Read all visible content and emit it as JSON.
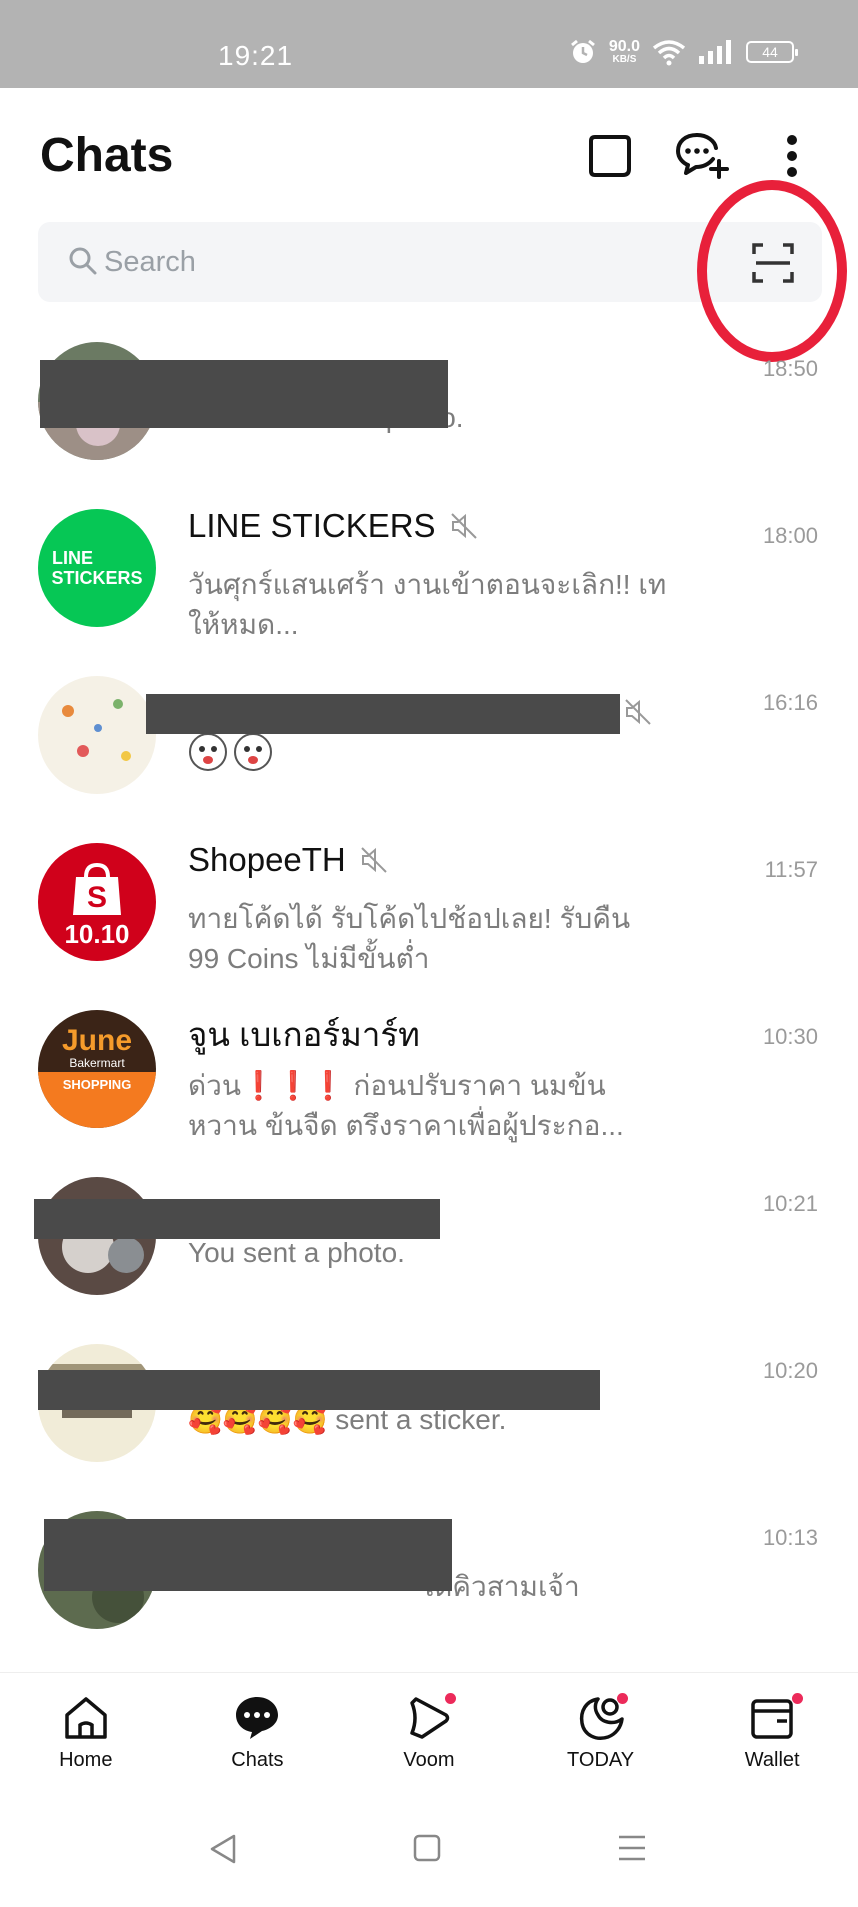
{
  "status_bar": {
    "time": "19:21",
    "net_speed_value": "90.0",
    "net_speed_unit": "KB/S",
    "battery": "44"
  },
  "header": {
    "title": "Chats"
  },
  "search": {
    "placeholder": "Search"
  },
  "chats": [
    {
      "name": "",
      "preview": "BaiBoon sent a photo.",
      "time": "18:50",
      "muted": false,
      "redacted": true
    },
    {
      "name": "LINE STICKERS",
      "preview": "วันศุกร์แสนเศร้า งานเข้าตอนจะเลิก!! เทให้หมด...",
      "time": "18:00",
      "muted": true,
      "avatar_text_1": "LINE",
      "avatar_text_2": "STICKERS"
    },
    {
      "name": "",
      "preview": "",
      "time": "16:16",
      "muted": true,
      "redacted": true
    },
    {
      "name": "ShopeeTH",
      "preview": "ทายโค้ดได้ รับโค้ดไปช้อปเลย! รับคืน 99 Coins ไม่มีขั้นต่ำ",
      "time": "11:57",
      "muted": true,
      "avatar_text": "10.10"
    },
    {
      "name": "จูน เบเกอร์มาร์ท",
      "preview": "ด่วน❗❗❗ ก่อนปรับราคา นมข้นหวาน ข้นจืด ตรึงราคาเพื่อผู้ประกอ...",
      "time": "10:30",
      "muted": false,
      "avatar_text_1": "June",
      "avatar_text_2": "Bakermart",
      "avatar_text_3": "SHOPPING"
    },
    {
      "name": "",
      "preview": "You sent a photo.",
      "time": "10:21",
      "muted": false,
      "redacted": true
    },
    {
      "name": "",
      "preview": "🥰🥰🥰🥰 sent a sticker.",
      "time": "10:20",
      "muted": true,
      "redacted": true
    },
    {
      "name": "",
      "preview": "ได้คิวสามเจ้า",
      "time": "10:13",
      "muted": false,
      "redacted": true
    }
  ],
  "bottom_nav": [
    {
      "label": "Home",
      "icon": "home-icon",
      "badge": false
    },
    {
      "label": "Chats",
      "icon": "chats-icon",
      "badge": false
    },
    {
      "label": "Voom",
      "icon": "voom-icon",
      "badge": true
    },
    {
      "label": "TODAY",
      "icon": "today-icon",
      "badge": true
    },
    {
      "label": "Wallet",
      "icon": "wallet-icon",
      "badge": true
    }
  ],
  "colors": {
    "line_green": "#06c755",
    "shopee_red": "#d0011b",
    "highlight_red": "#e8203a",
    "badge_pink": "#ec2a5a"
  }
}
